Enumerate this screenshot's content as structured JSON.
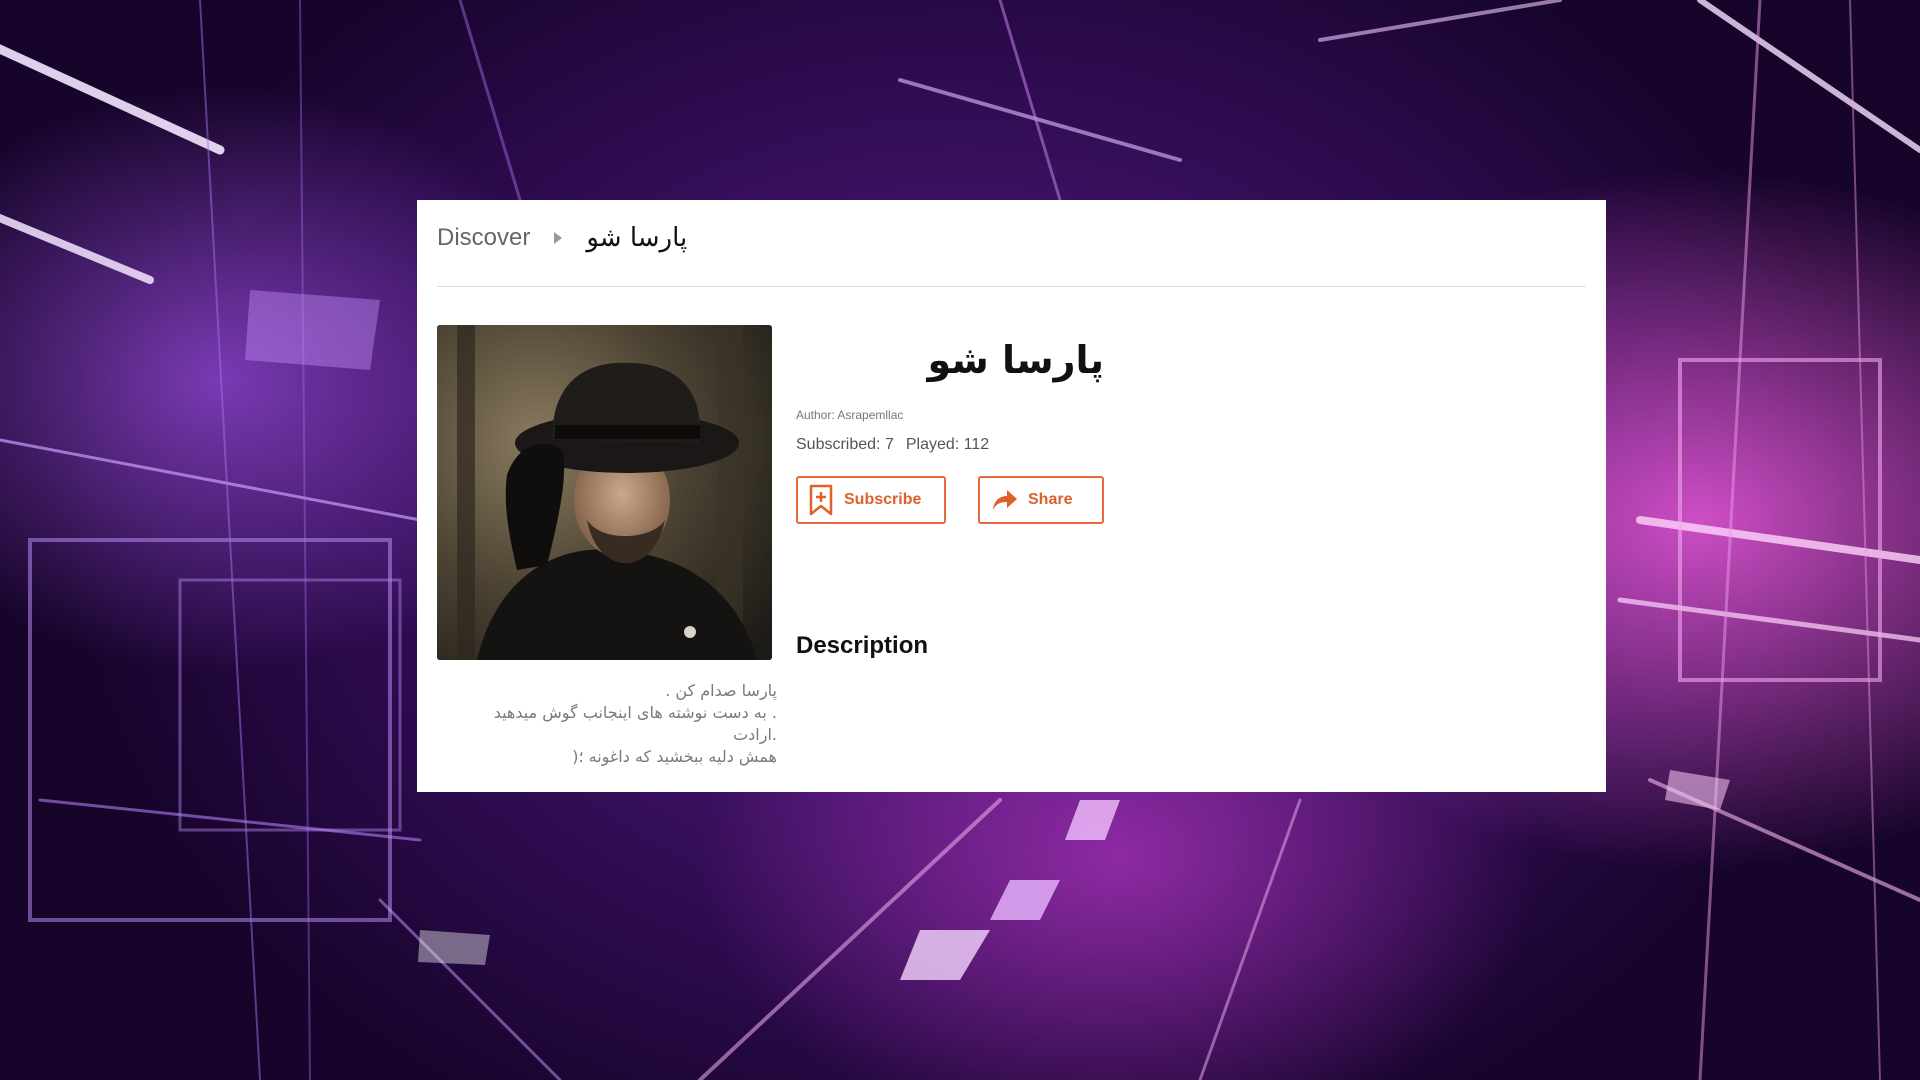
{
  "breadcrumb": {
    "discover_label": "Discover",
    "current_label": "پارسا شو"
  },
  "show": {
    "title": "پارسا شو",
    "author": "Author: Asrapemllac",
    "subscribed": "Subscribed: 7",
    "played": "Played: 112"
  },
  "actions": {
    "subscribe_label": "Subscribe",
    "share_label": "Share"
  },
  "description": {
    "heading": "Description",
    "lines": [
      "پارسا صدام کن .",
      ". به دست نوشته های اینجانب گوش میدهید",
      ".ارادت",
      "همش دلیه ببخشید که داغونه ؛("
    ]
  },
  "colors": {
    "accent": "#e8693a",
    "background_primary": "#4a1478",
    "background_highlight": "#e85ad8"
  },
  "icons": {
    "breadcrumb_separator": "caret-right-icon",
    "subscribe": "bookmark-plus-icon",
    "share": "share-arrow-icon"
  }
}
